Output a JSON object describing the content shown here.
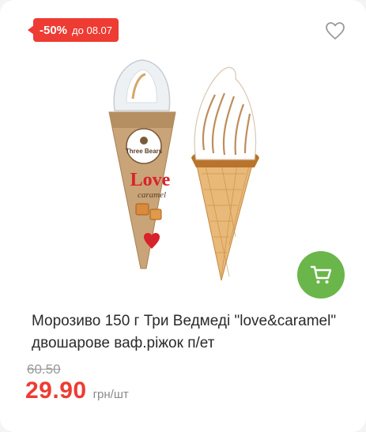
{
  "badge": {
    "discount": "-50%",
    "until": "до 08.07",
    "color": "#ee3b33"
  },
  "favorite": {
    "icon": "heart-outline-icon"
  },
  "image": {
    "icon": "ice-cream-cones-photo",
    "brand_text": "Three Bears",
    "flavor_text_1": "Love",
    "flavor_text_2": "caramel"
  },
  "cart": {
    "icon": "cart-icon",
    "color": "#6ab64a"
  },
  "product": {
    "title": "Морозиво 150 г Три Ведмеді \"love&caramel\" двошарове ваф.ріжок п/ет",
    "old_price": "60.50",
    "price": "29.90",
    "unit": "грн/шт"
  }
}
